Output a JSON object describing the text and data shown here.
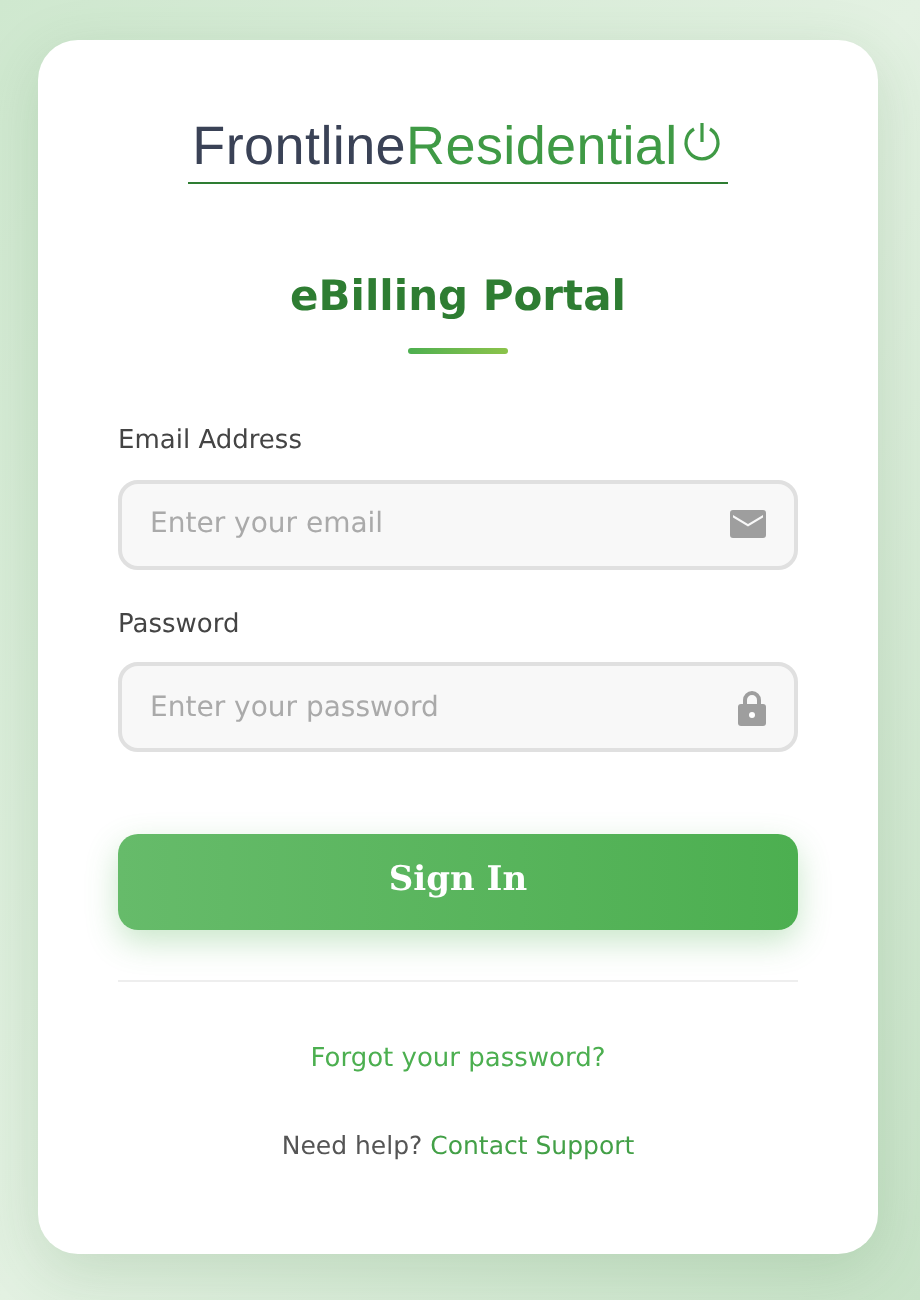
{
  "logo": {
    "part_1": "Frontline",
    "part_2": "Residential"
  },
  "title": "eBilling Portal",
  "fields": [
    {
      "kind": "email",
      "label": "Email Address",
      "placeholder": "Enter your email"
    },
    {
      "kind": "password",
      "label": "Password",
      "placeholder": "Enter your password"
    }
  ],
  "submit_button": "Sign In",
  "forgot_link": "Forgot your password?",
  "help": {
    "text": "Need help?",
    "link": "Contact Support"
  }
}
